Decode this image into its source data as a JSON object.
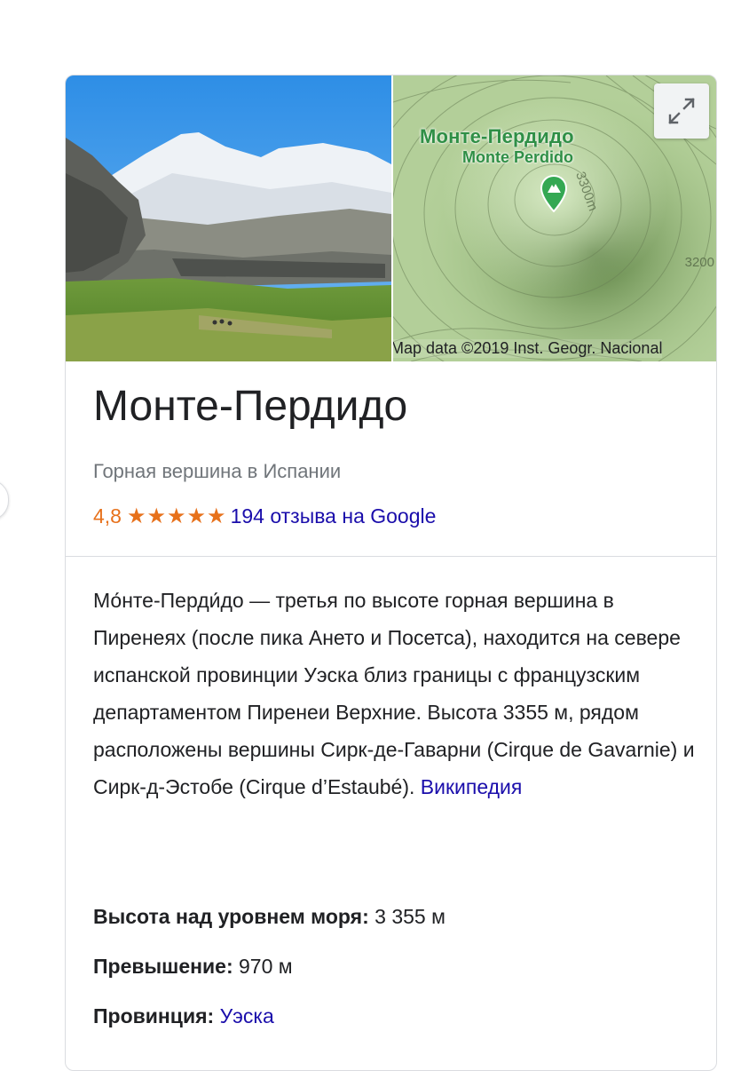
{
  "map": {
    "label_ru": "Монте-Пердидо",
    "label_lat": "Monte Perdido",
    "contour_3200": "3200",
    "contour_near_pin": "3300m",
    "attribution": "Map data ©2019 Inst. Geogr. Nacional",
    "expand_icon": "expand-arrows-icon",
    "pin_icon": "mountain-pin-icon"
  },
  "entity": {
    "title": "Монте-Пердидо",
    "subtitle": "Горная вершина в Испании"
  },
  "rating": {
    "value": "4,8",
    "stars": "★★★★★",
    "stars_count": 4.8,
    "reviews_link": "194 отзыва на Google",
    "color": "#e7711b"
  },
  "description": {
    "text": "Мо́нте-Перди́до — третья по высоте горная вершина в Пиренеях (после пика Ането и Посетса), находится на севере испанской провинции Уэска близ границы с французским департаментом Пиренеи Верхние. Высота 3355 м, рядом расположены вершины Сирк-де-Гаварни (Cirque de Gavarnie) и Сирк-д-Эстобе (Cirque d’Estaubé).",
    "source_link": "Википедия"
  },
  "facts": [
    {
      "key": "Высота над уровнем моря:",
      "value": "3 355 м",
      "is_link": false
    },
    {
      "key": "Превышение:",
      "value": "970 м",
      "is_link": false
    },
    {
      "key": "Провинция:",
      "value": "Уэска",
      "is_link": true
    }
  ],
  "colors": {
    "link": "#1a0dab",
    "map_label": "#2f8f46",
    "muted": "#70757a"
  }
}
